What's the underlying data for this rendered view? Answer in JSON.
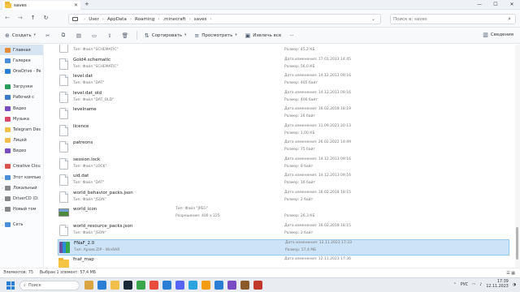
{
  "window": {
    "tab_title": "saves",
    "tab_close": "✕",
    "new_tab": "+",
    "controls": [
      "—",
      "☐",
      "✕"
    ]
  },
  "nav": {
    "back": "←",
    "forward": "→",
    "up": "↑",
    "refresh": "↻",
    "breadcrumbs": [
      "User",
      "AppData",
      "Roaming",
      ".minecraft",
      "saves"
    ],
    "search_placeholder": "Поиск в: saves"
  },
  "toolbar": {
    "create": "Создать",
    "sort": "Сортировать",
    "view": "Просмотреть",
    "extract": "Извлечь все",
    "more": "···",
    "details": "Сведения"
  },
  "sidebar": [
    {
      "label": "Главная",
      "selected": true,
      "chev": "",
      "color": "#e58a3a"
    },
    {
      "label": "Галерея",
      "chev": "",
      "color": "#4a8fd9"
    },
    {
      "label": "OneDrive - Pe",
      "chev": "›",
      "color": "#2a7fd4"
    },
    {
      "gap": true
    },
    {
      "label": "Загрузки",
      "chev": "",
      "color": "#2a9d5c"
    },
    {
      "label": "Рабочий с",
      "chev": "",
      "color": "#3a78c9"
    },
    {
      "label": "Видео",
      "chev": "",
      "color": "#7a4cc4"
    },
    {
      "label": "Музыка",
      "chev": "",
      "color": "#d94a6a"
    },
    {
      "label": "Telegram Des",
      "chev": "",
      "color": "#f2c04a"
    },
    {
      "label": "Лицей",
      "chev": "",
      "color": "#f2c04a"
    },
    {
      "label": "Видео",
      "chev": "",
      "color": "#7a4cc4"
    },
    {
      "gap": true
    },
    {
      "label": "Creative Clou",
      "chev": "›",
      "color": "#d9534f"
    },
    {
      "label": "Этот компью",
      "chev": "⌄",
      "color": "#4a8fd9"
    },
    {
      "label": "Локальный",
      "chev": "›",
      "color": "#888888"
    },
    {
      "label": "DriverCD (D:",
      "chev": "›",
      "color": "#888888"
    },
    {
      "label": "Новый том",
      "chev": "›",
      "color": "#888888"
    },
    {
      "gap": true
    },
    {
      "label": "Сеть",
      "chev": "›",
      "color": "#4a8fd9"
    }
  ],
  "files": [
    {
      "name": "Gold3.schematic",
      "type": "Тип: Файл \"SCHEMATIC\"",
      "date": "Дата изменения: 17.01.2013 14:45",
      "size": "Размер: 45,2 КБ",
      "icon": "file"
    },
    {
      "name": "Gold4.schematic",
      "type": "Тип: Файл \"SCHEMATIC\"",
      "date": "Дата изменения: 17.01.2013 14:45",
      "size": "Размер: 56,0 КБ",
      "icon": "file"
    },
    {
      "name": "level.dat",
      "type": "Тип: Файл \"DAT\"",
      "date": "Дата изменения: 14.12.2013 09:16",
      "size": "Размер: 405 байт",
      "icon": "file"
    },
    {
      "name": "level.dat_old",
      "type": "Тип: Файл \"DAT_OLD\"",
      "date": "Дата изменения: 14.12.2013 09:16",
      "size": "Размер: 406 байт",
      "icon": "file"
    },
    {
      "name": "levelname",
      "type": "",
      "date": "Дата изменения: 16.02.2018 18:19",
      "size": "Размер: 26 байт",
      "icon": "file"
    },
    {
      "name": "licence",
      "type": "",
      "date": "Дата изменения: 11.09.2021 20:13",
      "size": "Размер: 1,00 КБ",
      "icon": "file"
    },
    {
      "name": "patreons",
      "type": "",
      "date": "Дата изменения: 26.02.2022 14:49",
      "size": "Размер: 75 байт",
      "icon": "file"
    },
    {
      "name": "session.lock",
      "type": "Тип: Файл \"LOCK\"",
      "date": "Дата изменения: 14.12.2013 09:16",
      "size": "Размер: 8 байт",
      "icon": "file"
    },
    {
      "name": "uid.dat",
      "type": "Тип: Файл \"DAT\"",
      "date": "Дата изменения: 14.12.2013 09:16",
      "size": "Размер: 16 байт",
      "icon": "file"
    },
    {
      "name": "world_behavior_packs.json",
      "type": "Тип: Файл \"JSON\"",
      "date": "Дата изменения: 16.02.2018 18:15",
      "size": "Размер: 2 байт",
      "icon": "file"
    },
    {
      "name": "world_icon",
      "type": "",
      "mid1": "Тип: Файл \"JPEG\"",
      "mid2": "Разрешение: 400 x 225",
      "date": "",
      "size": "Размер: 26,3 КБ",
      "icon": "thumb"
    },
    {
      "name": "world_resource_packs.json",
      "type": "Тип: Файл \"JSON\"",
      "date": "Дата изменения: 16.02.2018 18:15",
      "size": "Размер: 2 байт",
      "icon": "file"
    },
    {
      "name": "FNaF_2.0",
      "type": "Тип: Архив ZIP - WinRAR",
      "date": "Дата изменения: 12.11.2023 17:33",
      "size": "Размер: 57,4 МБ",
      "icon": "archive",
      "selected": true
    },
    {
      "name": "fnaf_map",
      "type": "",
      "date": "Дата изменения: 12.11.2023 17:36",
      "size": "",
      "icon": "folder"
    }
  ],
  "status": {
    "count": "Элементов: 75",
    "selection": "Выбран 1 элемент: 57,4 МБ"
  },
  "taskbar": {
    "search": "Поиск",
    "app_colors": [
      "#d9a441",
      "#2a7fd4",
      "#f2c04a",
      "#1b2838",
      "#3aa64c",
      "#e74c3c",
      "#2a7fd4",
      "#5865f2",
      "#2aa3df",
      "#f39c12",
      "#2a7fd4",
      "#7a4cc4",
      "#8b5a2b",
      "#c0392b"
    ],
    "lang": "РУС",
    "time": "17:39",
    "date": "12.11.2023"
  }
}
